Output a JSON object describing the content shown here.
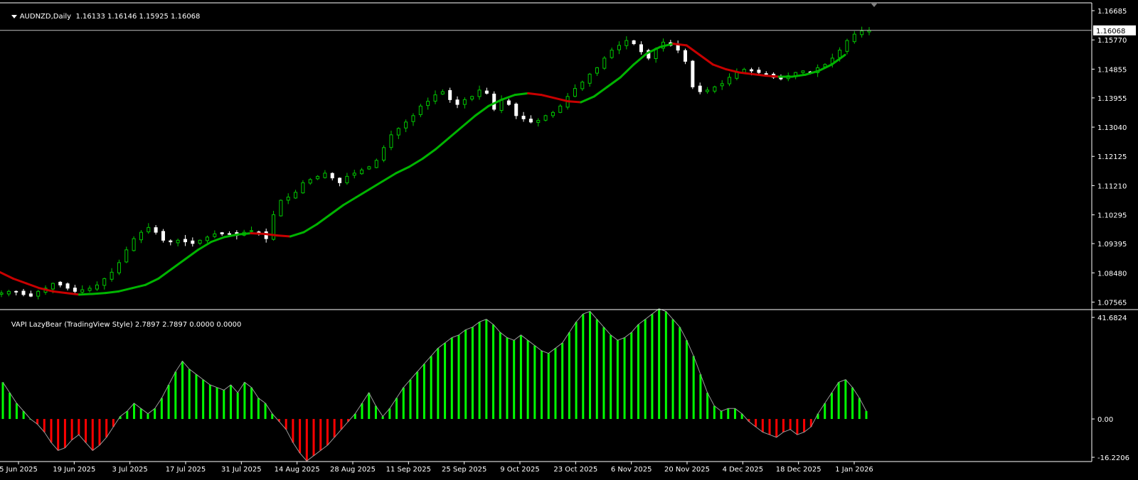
{
  "window": {
    "symbol_line": "AUDNZD,Daily",
    "ohlc_line": "1.16133 1.16146 1.15925 1.16068",
    "indicator_line": "VAPI LazyBear (TradingView Style) 2.7897 2.7897 0.0000 0.0000"
  },
  "colors": {
    "background": "#000000",
    "axis": "#ffffff",
    "candle_up": "#00c800",
    "candle_down": "#ffffff",
    "ma_up": "#00b400",
    "ma_down": "#c80000",
    "hist_pos": "#00ff00",
    "hist_neg": "#ff0000",
    "price_line": "#c0c0c0"
  },
  "price_axis": {
    "ticks": [
      "1.16685",
      "1.15770",
      "1.14855",
      "1.13955",
      "1.13040",
      "1.12125",
      "1.11210",
      "1.10295",
      "1.09395",
      "1.08480",
      "1.07565"
    ],
    "current_price_label": "1.16068"
  },
  "indicator_axis": {
    "ticks": [
      "41.6824",
      "0.00",
      "-16.2206"
    ]
  },
  "time_axis": {
    "labels": [
      "5 Jun 2025",
      "19 Jun 2025",
      "3 Jul 2025",
      "17 Jul 2025",
      "31 Jul 2025",
      "14 Aug 2025",
      "28 Aug 2025",
      "11 Sep 2025",
      "25 Sep 2025",
      "9 Oct 2025",
      "23 Oct 2025",
      "6 Nov 2025",
      "20 Nov 2025",
      "4 Dec 2025",
      "18 Dec 2025",
      "1 Jan 2026"
    ]
  },
  "chart_data": [
    {
      "type": "candlestick",
      "title": "AUDNZD,Daily",
      "current_price": 1.16068,
      "last_bar": {
        "open": 1.16133,
        "high": 1.16146,
        "low": 1.15925,
        "close": 1.16068
      },
      "ylim": [
        1.0733,
        1.1693
      ],
      "x_labels": [
        "5 Jun 2025",
        "19 Jun 2025",
        "3 Jul 2025",
        "17 Jul 2025",
        "31 Jul 2025",
        "14 Aug 2025",
        "28 Aug 2025",
        "11 Sep 2025",
        "25 Sep 2025",
        "9 Oct 2025",
        "23 Oct 2025",
        "6 Nov 2025",
        "20 Nov 2025",
        "4 Dec 2025",
        "18 Dec 2025",
        "1 Jan 2026"
      ],
      "close_path": [
        1.0785,
        1.079,
        1.079,
        1.078,
        1.0775,
        1.079,
        1.08,
        1.0815,
        1.081,
        1.08,
        1.079,
        1.0795,
        1.08,
        1.081,
        1.083,
        1.085,
        1.088,
        1.092,
        1.0955,
        1.0975,
        1.099,
        1.0975,
        1.095,
        1.0945,
        1.095,
        1.0945,
        1.094,
        1.095,
        1.096,
        1.097,
        1.097,
        1.097,
        1.0965,
        1.0975,
        1.098,
        1.0975,
        1.0955,
        1.103,
        1.1075,
        1.1085,
        1.11,
        1.113,
        1.114,
        1.115,
        1.116,
        1.1145,
        1.113,
        1.115,
        1.116,
        1.117,
        1.118,
        1.12,
        1.124,
        1.128,
        1.13,
        1.132,
        1.134,
        1.137,
        1.1385,
        1.1405,
        1.1415,
        1.139,
        1.1375,
        1.139,
        1.14,
        1.142,
        1.141,
        1.136,
        1.139,
        1.1375,
        1.134,
        1.133,
        1.132,
        1.1325,
        1.134,
        1.135,
        1.137,
        1.14,
        1.1425,
        1.1445,
        1.147,
        1.149,
        1.152,
        1.1545,
        1.156,
        1.1575,
        1.1565,
        1.154,
        1.152,
        1.155,
        1.157,
        1.156,
        1.1545,
        1.151,
        1.143,
        1.1415,
        1.142,
        1.143,
        1.144,
        1.146,
        1.1475,
        1.1485,
        1.148,
        1.1475,
        1.147,
        1.146,
        1.1455,
        1.1465,
        1.1475,
        1.148,
        1.1475,
        1.149,
        1.15,
        1.152,
        1.1545,
        1.1575,
        1.1595,
        1.1605,
        1.1607
      ],
      "series": [
        {
          "name": "price",
          "type": "candle"
        },
        {
          "type": "line",
          "path": [
            1.085,
            1.083,
            1.0815,
            1.08,
            1.079,
            1.0785,
            1.078,
            1.0782,
            1.0785,
            1.079,
            1.08,
            1.081,
            1.083,
            1.086,
            1.089,
            1.092,
            1.0945,
            1.096,
            1.0968,
            1.0972,
            1.097,
            1.0965,
            1.0962,
            1.0975,
            1.1,
            1.103,
            1.106,
            1.1085,
            1.111,
            1.1135,
            1.116,
            1.118,
            1.1205,
            1.1235,
            1.127,
            1.1305,
            1.134,
            1.137,
            1.139,
            1.1405,
            1.141,
            1.1405,
            1.1395,
            1.1385,
            1.1382,
            1.14,
            1.143,
            1.146,
            1.15,
            1.1535,
            1.1555,
            1.1565,
            1.156,
            1.153,
            1.15,
            1.1485,
            1.1475,
            1.147,
            1.1465,
            1.1462,
            1.1462,
            1.1468,
            1.148,
            1.15,
            1.153
          ]
        }
      ]
    },
    {
      "type": "bar",
      "title": "VAPI LazyBear (TradingView Style)",
      "values_shown": [
        2.7897,
        2.7897,
        0.0,
        0.0
      ],
      "ylim": [
        -16.2206,
        41.6824
      ],
      "series": [
        {
          "type": "histogram",
          "values": [
            14,
            10,
            6,
            3,
            0,
            -2,
            -5,
            -9,
            -12,
            -11,
            -8,
            -6,
            -9,
            -12,
            -10,
            -7,
            -3,
            1,
            3,
            6,
            4,
            2,
            4,
            8,
            13,
            18,
            22,
            19,
            17,
            15,
            13,
            12,
            11,
            13,
            10,
            14,
            12,
            8,
            6,
            2,
            -1,
            -4,
            -9,
            -13,
            -16,
            -14,
            -12,
            -10,
            -7,
            -4,
            -1,
            2,
            6,
            10,
            5,
            1,
            4,
            8,
            12,
            15,
            18,
            21,
            24,
            27,
            29,
            31,
            32,
            34,
            35,
            37,
            38,
            36,
            33,
            31,
            30,
            32,
            30,
            28,
            26,
            25,
            27,
            29,
            33,
            37,
            40,
            41,
            38,
            35,
            32,
            30,
            31,
            33,
            36,
            38,
            40,
            42,
            41,
            38,
            35,
            30,
            24,
            17,
            10,
            5,
            3,
            4,
            4,
            2,
            -1,
            -3,
            -5,
            -6,
            -7,
            -5,
            -4,
            -6,
            -5,
            -3,
            2,
            6,
            10,
            14,
            15,
            12,
            8,
            3
          ]
        }
      ]
    }
  ]
}
